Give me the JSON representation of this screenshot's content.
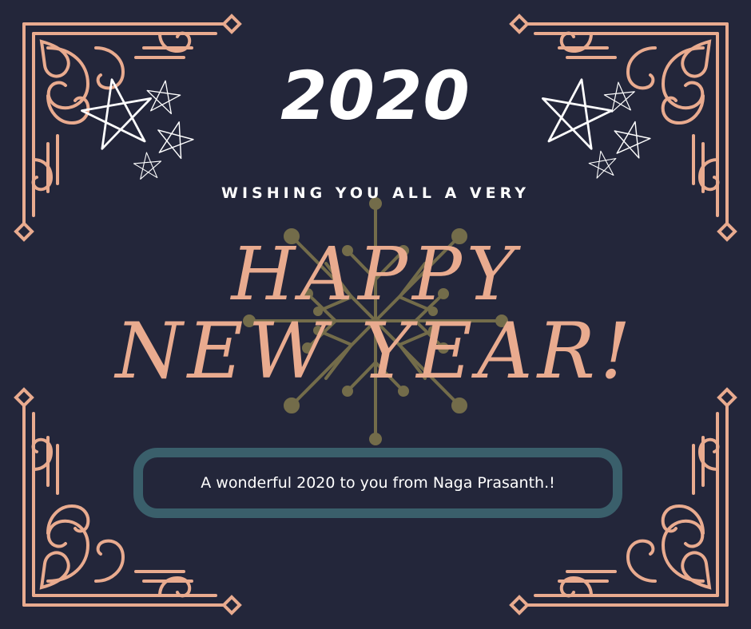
{
  "card": {
    "year": "2020",
    "wishing": "WISHING YOU ALL A VERY",
    "happy": "HAPPY",
    "new_year": "NEW YEAR!",
    "message": "A wonderful 2020 to you from Naga Prasanth.!"
  },
  "colors": {
    "background": "#23263a",
    "ornament": "#e9ab8f",
    "snowflake": "#736c4a",
    "message_border": "#3a5f6b",
    "text": "#ffffff"
  },
  "icons": [
    "corner-ornament",
    "star-icon",
    "snowflake-icon"
  ]
}
